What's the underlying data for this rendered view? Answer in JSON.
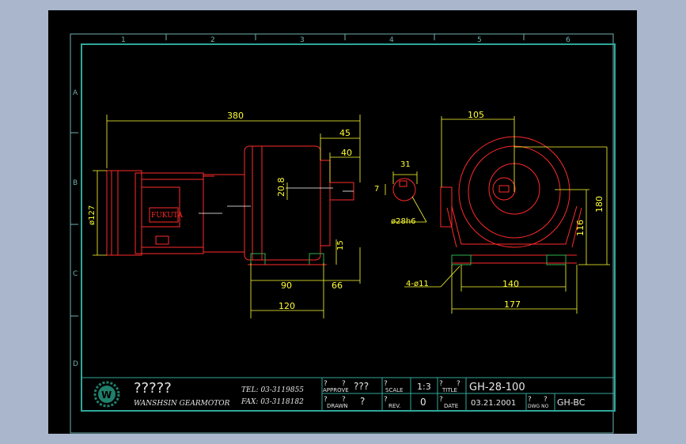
{
  "colors": {
    "background": "#a9b6cc",
    "canvas": "#000000",
    "frame": "#6fb0b0",
    "inner_border": "#2fa79a",
    "drawing": "#ff2a2a",
    "dimension": "#ffff33",
    "title_text": "#e6e6e6",
    "logo": "#1f7f6a",
    "green_feet": "#2fb04f"
  },
  "grid": {
    "columns": [
      "1",
      "2",
      "3",
      "4",
      "5",
      "6"
    ],
    "rows": [
      "A",
      "B",
      "C",
      "D"
    ]
  },
  "dimensions": {
    "overall_length": "380",
    "shaft_length_outer": "45",
    "shaft_length_inner": "40",
    "shaft_height": "20.8",
    "motor_diameter": "ø127",
    "foot_90": "90",
    "foot_66": "66",
    "foot_120": "120",
    "foot_height": "15",
    "key_width": "7",
    "shaft_key_depth": "31",
    "shaft_diameter": "ø28h6",
    "end_width_105": "105",
    "end_height_180": "180",
    "end_height_116": "116",
    "bolt_holes": "4-ø11",
    "base_140": "140",
    "base_177": "177"
  },
  "nameplate": "FUKUTA",
  "title_block": {
    "company_glyphs": "?????",
    "company_name": "WANSHSIN GEARMOTOR",
    "tel": "TEL: 03-3119855",
    "fax": "FAX: 03-3118182",
    "approve_label": "APPROVE",
    "approve_value": "???",
    "drawn_label": "DRAWN",
    "drawn_value": "?",
    "scale_label": "SCALE",
    "scale_value": "1:3",
    "rev_label": "REV.",
    "rev_value": "0",
    "title_label": "TITLE",
    "title_value": "GH-28-100",
    "date_label": "DATE",
    "date_value": "03.21.2001",
    "dwg_label": "DWG NO",
    "dwg_value": "GH-BC",
    "q": "?"
  }
}
